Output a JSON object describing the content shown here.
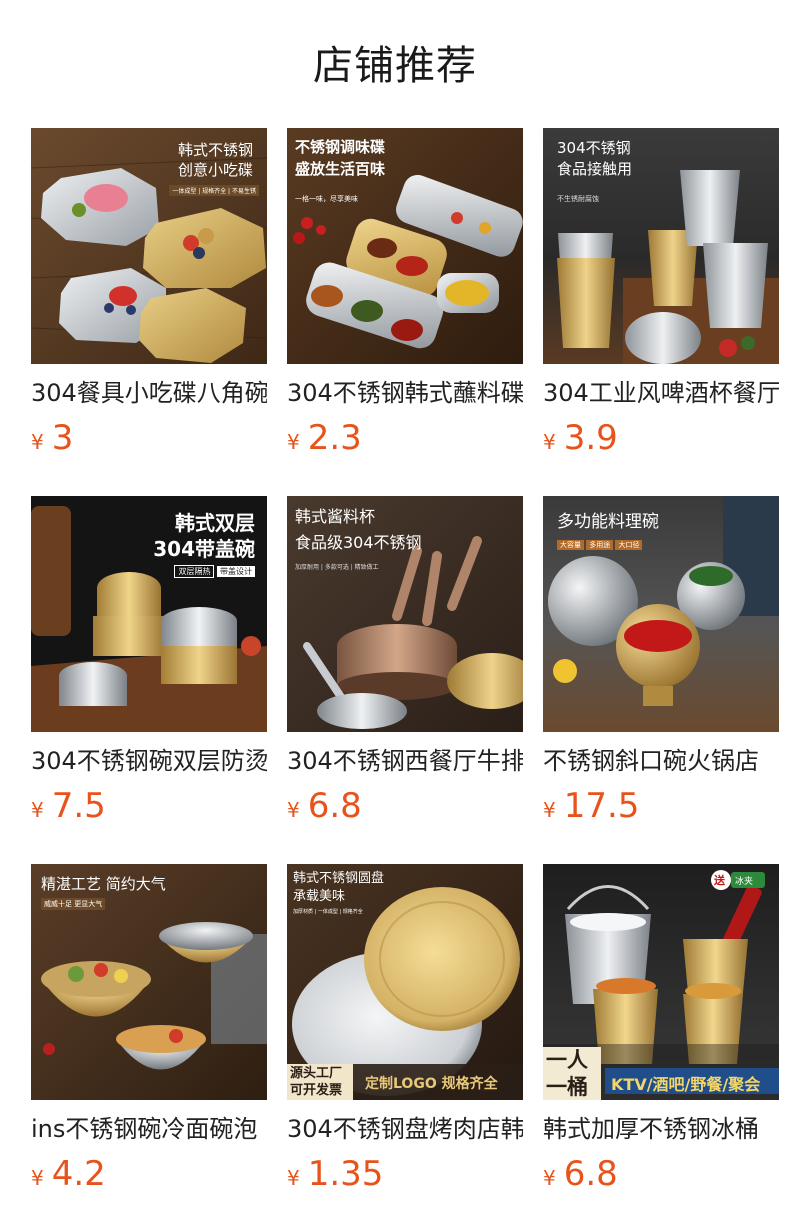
{
  "page_title": "店铺推荐",
  "colors": {
    "price": "#e8531c",
    "title": "#1a1a1a"
  },
  "products": [
    {
      "name": "304餐具小吃碟八角碗",
      "currency": "¥",
      "price": "3",
      "image": {
        "icon": "octagon-plates-photo",
        "texts": [
          "韩式不锈钢",
          "创意小吃碟",
          "一体成型 | 规格齐全 | 不易生锈"
        ]
      }
    },
    {
      "name": "304不锈钢韩式蘸料碟",
      "currency": "¥",
      "price": "2.3",
      "image": {
        "icon": "sauce-dish-photo",
        "texts": [
          "不锈钢调味碟",
          "盛放生活百味",
          "一格一味，尽享美味"
        ]
      }
    },
    {
      "name": "304工业风啤酒杯餐厅",
      "currency": "¥",
      "price": "3.9",
      "image": {
        "icon": "metal-cups-photo",
        "texts": [
          "304不锈钢",
          "食品接触用",
          "不生锈耐腐蚀"
        ]
      }
    },
    {
      "name": "304不锈钢碗双层防烫",
      "currency": "¥",
      "price": "7.5",
      "image": {
        "icon": "lidded-bowls-photo",
        "texts": [
          "韩式双层",
          "304带盖碗",
          "双层隔热",
          "带盖设计"
        ]
      }
    },
    {
      "name": "304不锈钢西餐厅牛排",
      "currency": "¥",
      "price": "6.8",
      "image": {
        "icon": "sauce-cups-photo",
        "texts": [
          "韩式酱料杯",
          "食品级304不锈钢",
          "加厚耐用 | 多款可选 | 精致做工"
        ]
      }
    },
    {
      "name": "不锈钢斜口碗火锅店",
      "currency": "¥",
      "price": "17.5",
      "image": {
        "icon": "slanted-bowls-photo",
        "texts": [
          "多功能料理碗",
          "大容量",
          "多用途",
          "大口径"
        ]
      }
    },
    {
      "name": "ins不锈钢碗冷面碗泡",
      "currency": "¥",
      "price": "4.2",
      "image": {
        "icon": "noodle-bowls-photo",
        "texts": [
          "精湛工艺 简约大气",
          "威威十足 更显大气"
        ]
      }
    },
    {
      "name": "304不锈钢盘烤肉店韩",
      "currency": "¥",
      "price": "1.35",
      "image": {
        "icon": "round-plates-photo",
        "texts": [
          "韩式不锈钢圆盘",
          "承载美味",
          "加厚材质 | 一体成型 | 规格齐全",
          "源头工厂",
          "可开发票",
          "定制LOGO 规格齐全"
        ]
      }
    },
    {
      "name": "韩式加厚不锈钢冰桶",
      "currency": "¥",
      "price": "6.8",
      "image": {
        "icon": "ice-buckets-photo",
        "texts": [
          "送",
          "冰夹",
          "一人",
          "一桶",
          "KTV/酒吧/野餐/聚会"
        ]
      }
    }
  ]
}
